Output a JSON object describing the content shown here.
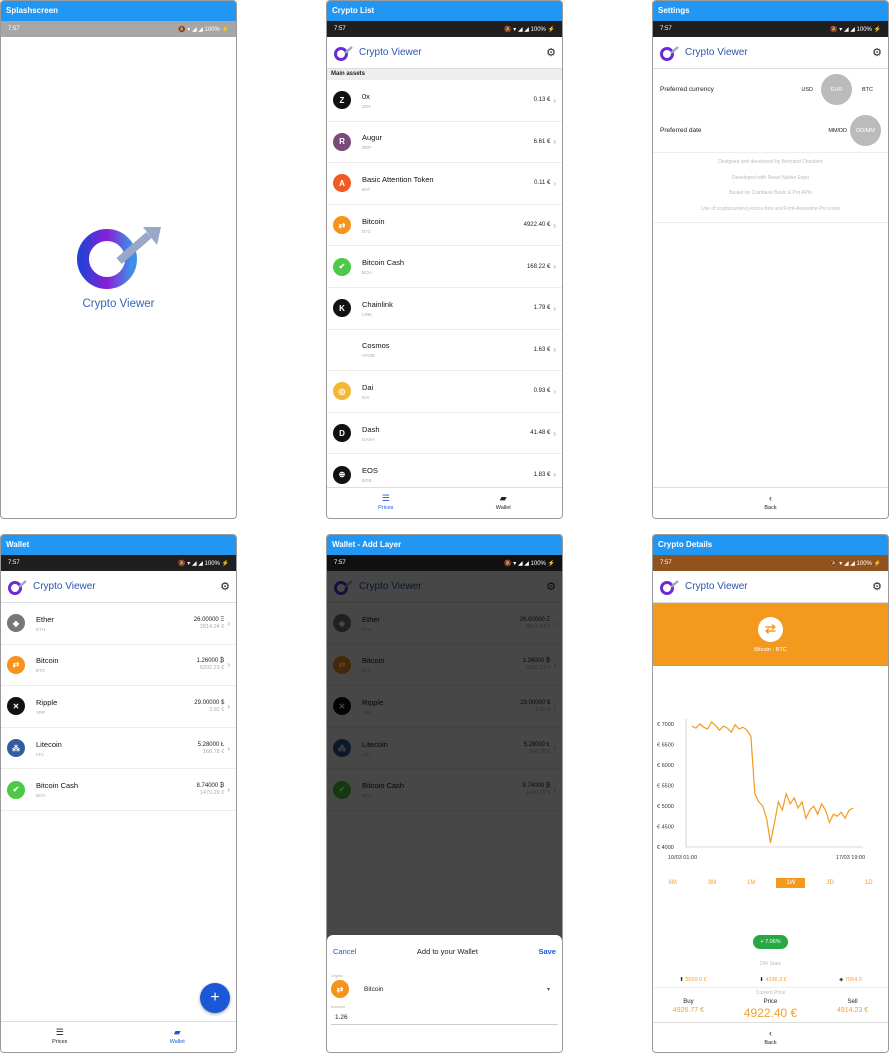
{
  "status": {
    "time": "7:57",
    "icons": "🔕 ▾ ◢ ◢",
    "battery": "100% ⚡"
  },
  "brand": {
    "name": "Crypto Viewer"
  },
  "splash": {
    "title": "Splashscreen",
    "brand": "Crypto Viewer"
  },
  "list": {
    "title": "Crypto List",
    "section": "Main assets",
    "items": [
      {
        "name": "0x",
        "sym": "ZRX",
        "price": "0.13 €",
        "color": "#111",
        "glyph": "Z"
      },
      {
        "name": "Augur",
        "sym": "REP",
        "price": "6.61 €",
        "color": "#7a4a79",
        "glyph": "R"
      },
      {
        "name": "Basic Attention Token",
        "sym": "BAT",
        "price": "0.11 €",
        "color": "#f15a22",
        "glyph": "A"
      },
      {
        "name": "Bitcoin",
        "sym": "BTC",
        "price": "4922.40 €",
        "color": "#f7931a",
        "glyph": "⇄"
      },
      {
        "name": "Bitcoin Cash",
        "sym": "BCH",
        "price": "168.22 €",
        "color": "#4cc947",
        "glyph": "✔"
      },
      {
        "name": "Chainlink",
        "sym": "LINK",
        "price": "1.79 €",
        "color": "#111",
        "glyph": "K"
      },
      {
        "name": "Cosmos",
        "sym": "ATOM",
        "price": "1.63 €",
        "color": "#ffffff",
        "glyph": ""
      },
      {
        "name": "Dai",
        "sym": "DAI",
        "price": "0.93 €",
        "color": "#f4b731",
        "glyph": "◎"
      },
      {
        "name": "Dash",
        "sym": "DASH",
        "price": "41.48 €",
        "color": "#111",
        "glyph": "D"
      },
      {
        "name": "EOS",
        "sym": "EOS",
        "price": "1.83 €",
        "color": "#111",
        "glyph": "⊕"
      }
    ]
  },
  "tabs": {
    "prices": "Prices",
    "wallet": "Wallet",
    "back": "Back"
  },
  "settings": {
    "title": "Settings",
    "currency_label": "Preferred currency",
    "currency_opts": [
      "USD",
      "EUR",
      "BTC"
    ],
    "date_label": "Preferred date",
    "date_opts": [
      "MM/DD",
      "DD/MM"
    ],
    "credits": [
      "Designed and developed by Bertrand Choubert",
      "Developed with React Native Expo",
      "Based on Coinbase Basic & Pro APIs",
      "Use of cryptocurrency-icons-font and Font-Awesome Pro icons"
    ]
  },
  "wallet": {
    "title": "Wallet",
    "items": [
      {
        "name": "Ether",
        "sym": "ETH",
        "amount": "26.00000 Ξ",
        "value": "2814.24 €",
        "color": "#777",
        "glyph": "◆"
      },
      {
        "name": "Bitcoin",
        "sym": "BTC",
        "amount": "1.26000 ₿",
        "value": "6202.23 €",
        "color": "#f7931a",
        "glyph": "⇄"
      },
      {
        "name": "Ripple",
        "sym": "XRP",
        "amount": "29.00000 $",
        "value": "3.92 €",
        "color": "#111",
        "glyph": "✕"
      },
      {
        "name": "Litecoin",
        "sym": "LTC",
        "amount": "5.28000 Ł",
        "value": "166.78 €",
        "color": "#345d9d",
        "glyph": "⁂"
      },
      {
        "name": "Bitcoin Cash",
        "sym": "BCH",
        "amount": "8.74000 ₿",
        "value": "1470.29 €",
        "color": "#4cc947",
        "glyph": "✔"
      }
    ],
    "fab": "+"
  },
  "add": {
    "title": "Wallet - Add Layer",
    "cancel": "Cancel",
    "heading": "Add to your Wallet",
    "save": "Save",
    "crypto_label": "Crypto",
    "crypto_value": "Bitcoin",
    "amount_label": "Amount",
    "amount_value": "1.26"
  },
  "details": {
    "title": "Crypto Details",
    "coin": "Bitcoin - BTC",
    "accent": "#f39a1e",
    "ranges": [
      "6M",
      "3M",
      "1M",
      "1W",
      "3D",
      "1D"
    ],
    "active_range": "1W",
    "change": "+ 7.06%",
    "stats_label": "24h Stats",
    "high": "5020.0 €",
    "low": "4336.3 €",
    "volume": "7064.0",
    "current_label": "Current Price",
    "buy_label": "Buy",
    "buy": "4926.77 €",
    "price_label": "Price",
    "price": "4922.40 €",
    "sell_label": "Sell",
    "sell": "4914.23 €"
  },
  "chart_data": {
    "type": "line",
    "ylim": [
      4000,
      7000
    ],
    "yticks": [
      "€ 7000",
      "€ 6500",
      "€ 6000",
      "€ 5500",
      "€ 5000",
      "€ 4500",
      "€ 4000"
    ],
    "xticks": [
      "10/03 01:00",
      "17/03 19:00"
    ],
    "values": [
      6950,
      6900,
      7000,
      6920,
      6880,
      7050,
      6960,
      6850,
      6950,
      6900,
      6800,
      6980,
      6880,
      6920,
      6850,
      6700,
      5300,
      5100,
      5000,
      4700,
      4100,
      4600,
      5100,
      4900,
      5300,
      5050,
      5200,
      4950,
      5100,
      4700,
      4900,
      5000,
      4800,
      5050,
      4900,
      4600,
      4800,
      4750,
      4850,
      4700,
      4900,
      4950
    ]
  }
}
